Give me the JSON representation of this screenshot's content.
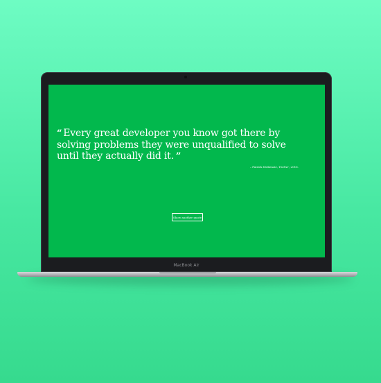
{
  "device": {
    "model_label": "MacBook Air"
  },
  "quote": {
    "open_mark": "“",
    "text": "Every great developer you know got there by solving problems they were unqualified to solve until they actually did it.",
    "close_mark": "”",
    "attribution_prefix": "– Patrick McKenzie, ",
    "attribution_source": "Twitter",
    "attribution_year": ", 2016."
  },
  "actions": {
    "new_quote_label": "Show another quote"
  },
  "colors": {
    "background": "#5ef2b3",
    "display_background": "#02b84d",
    "text": "#ffffff"
  }
}
